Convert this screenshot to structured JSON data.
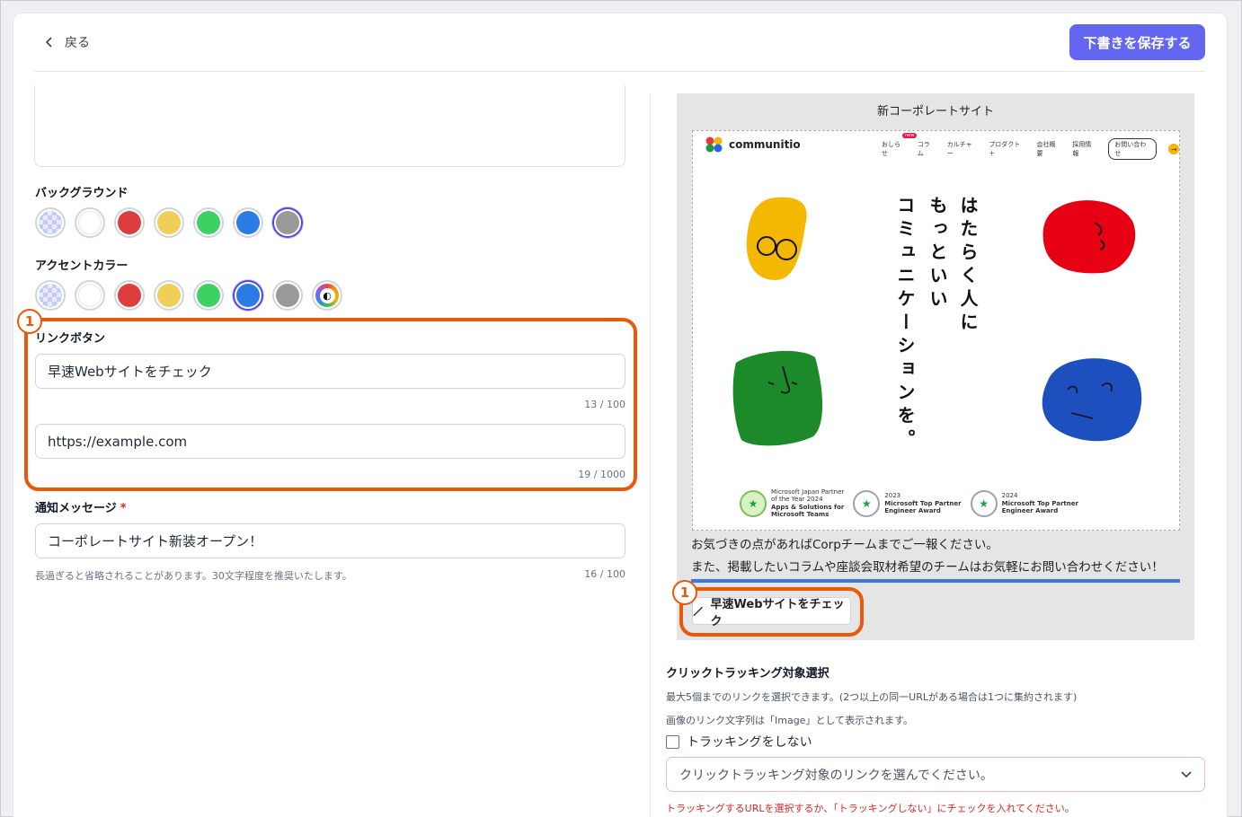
{
  "header": {
    "back_label": "戻る",
    "save_label": "下書きを保存する"
  },
  "background": {
    "label": "バックグラウンド",
    "swatches": [
      "transparent",
      "#ffffff",
      "#dc3d3d",
      "#efcf57",
      "#3dd162",
      "#2c7be5",
      "#999999"
    ],
    "selected_index": 6
  },
  "accent": {
    "label": "アクセントカラー",
    "swatches": [
      "transparent",
      "#ffffff",
      "#dc3d3d",
      "#efcf57",
      "#3dd162",
      "#2c7be5",
      "#999999",
      "custom"
    ],
    "selected_index": 5
  },
  "link_button": {
    "label": "リンクボタン",
    "text_value": "早速Webサイトをチェック",
    "text_counter": "13 / 100",
    "url_value": "https://example.com",
    "url_counter": "19 / 1000"
  },
  "notification": {
    "label": "通知メッセージ",
    "required_mark": "*",
    "value": "コーポレートサイト新装オープン！",
    "hint": "長過ぎると省略されることがあります。30文字程度を推奨いたします。",
    "counter": "16 / 100"
  },
  "callouts": {
    "number": "1"
  },
  "preview": {
    "title": "新コーポレートサイト",
    "brand": "communitio",
    "nav": [
      "おしらせ",
      "コラム",
      "カルチャー",
      "プロダクト＋",
      "会社概要",
      "採用情報"
    ],
    "nav_new": "new",
    "nav_contact": "お問い合わせ",
    "headline_col1": "はたらく人に",
    "headline_col2": "もっといい",
    "headline_col3": "コミュニケーションを。",
    "awards": [
      {
        "line1": "Microsoft Japan Partner",
        "line2": "of the Year 2024",
        "line3": "Apps & Solutions for",
        "line4": "Microsoft Teams"
      },
      {
        "line1": "2023",
        "line2": "Microsoft Top Partner",
        "line3": "Engineer Award"
      },
      {
        "line1": "2024",
        "line2": "Microsoft Top Partner",
        "line3": "Engineer Award"
      }
    ],
    "body_line1": "お気づきの点があればCorpチームまでご一報ください。",
    "body_line2": "また、掲載したいコラムや座談会取材希望のチームはお気軽にお問い合わせください！",
    "button_label": "早速Webサイトをチェック"
  },
  "tracking": {
    "title": "クリックトラッキング対象選択",
    "desc1": "最大5個までのリンクを選択できます。(2つ以上の同一URLがある場合は1つに集約されます)",
    "desc2": "画像のリンク文字列は「Image」として表示されます。",
    "no_tracking_label": "トラッキングをしない",
    "select_placeholder": "クリックトラッキング対象のリンクを選んでください。",
    "error": "トラッキングするURLを選択するか、「トラッキングしない」にチェックを入れてください。"
  },
  "colors": {
    "primary": "#6366f1",
    "callout": "#ea580c",
    "error": "#dc2626",
    "preview_bar": "#3b78e7"
  }
}
